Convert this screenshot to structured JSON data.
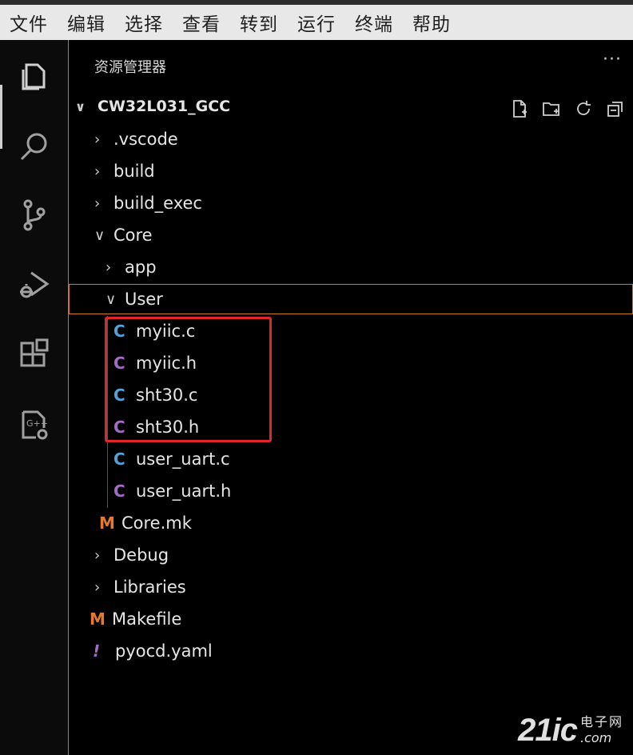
{
  "menubar": {
    "items": [
      "文件",
      "编辑",
      "选择",
      "查看",
      "转到",
      "运行",
      "终端",
      "帮助"
    ]
  },
  "activity_bar": {
    "icons": [
      "explorer-icon",
      "search-icon",
      "source-control-icon",
      "run-debug-icon",
      "extensions-icon",
      "cpp-settings-icon"
    ]
  },
  "sidebar": {
    "title": "资源管理器",
    "more": "···",
    "project": "CW32L031_GCC",
    "tools": [
      "new-file-icon",
      "new-folder-icon",
      "refresh-icon",
      "collapse-all-icon"
    ]
  },
  "tree": [
    {
      "label": ".vscode",
      "kind": "folder",
      "expanded": false
    },
    {
      "label": "build",
      "kind": "folder",
      "expanded": false
    },
    {
      "label": "build_exec",
      "kind": "folder",
      "expanded": false
    },
    {
      "label": "Core",
      "kind": "folder",
      "expanded": true
    },
    {
      "label": "app",
      "kind": "folder",
      "expanded": false
    },
    {
      "label": "User",
      "kind": "folder",
      "expanded": true,
      "selected": true
    },
    {
      "label": "myiic.c",
      "kind": "file",
      "icon": "C"
    },
    {
      "label": "myiic.h",
      "kind": "file",
      "icon": "C"
    },
    {
      "label": "sht30.c",
      "kind": "file",
      "icon": "C"
    },
    {
      "label": "sht30.h",
      "kind": "file",
      "icon": "C"
    },
    {
      "label": "user_uart.c",
      "kind": "file",
      "icon": "C"
    },
    {
      "label": "user_uart.h",
      "kind": "file",
      "icon": "C"
    },
    {
      "label": "Core.mk",
      "kind": "file",
      "icon": "M"
    },
    {
      "label": "Debug",
      "kind": "folder",
      "expanded": false
    },
    {
      "label": "Libraries",
      "kind": "folder",
      "expanded": false
    },
    {
      "label": "Makefile",
      "kind": "file",
      "icon": "M"
    },
    {
      "label": "pyocd.yaml",
      "kind": "file",
      "icon": "!"
    }
  ],
  "colors": {
    "c_icon": "#4fa3d8",
    "h_icon": "#a36ac7",
    "m_icon": "#e37933",
    "selection_border": "#d27a26",
    "highlight_box": "#e0252b"
  },
  "watermark": {
    "big": "21ic",
    "cn": "电子网",
    "domain": ".com"
  }
}
